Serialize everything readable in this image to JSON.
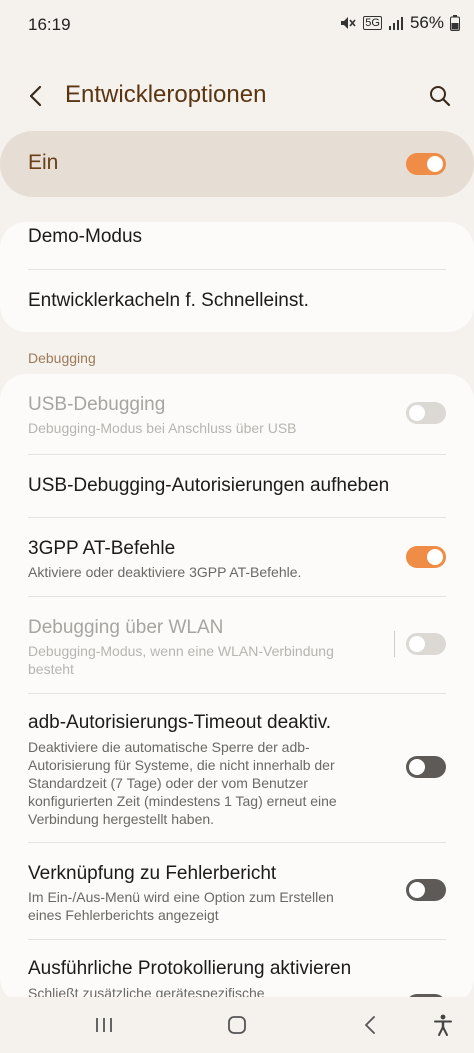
{
  "status_bar": {
    "time": "16:19",
    "network": "5G",
    "battery": "56%",
    "icons": [
      "mute-icon",
      "5g-icon",
      "signal-icon",
      "battery-icon"
    ]
  },
  "app_bar": {
    "title": "Entwickleroptionen",
    "back_icon": "back-arrow-icon",
    "search_icon": "search-icon"
  },
  "master_switch": {
    "label": "Ein",
    "on": true
  },
  "top_items": [
    {
      "title": "Demo-Modus"
    },
    {
      "title": "Entwicklerkacheln f. Schnelleinst."
    }
  ],
  "section": {
    "header": "Debugging"
  },
  "items": [
    {
      "title": "USB-Debugging",
      "subtitle": "Debugging-Modus bei Anschluss über USB",
      "switch": "off",
      "enabled": false
    },
    {
      "title": "USB-Debugging-Autorisierungen aufheben",
      "subtitle": "",
      "switch": "none",
      "enabled": true
    },
    {
      "title": "3GPP AT-Befehle",
      "subtitle": "Aktiviere oder deaktiviere 3GPP AT-Befehle.",
      "switch": "on",
      "enabled": true
    },
    {
      "title": "Debugging über WLAN",
      "subtitle": "Debugging-Modus, wenn eine WLAN-Verbindung besteht",
      "switch": "off",
      "enabled": false
    },
    {
      "title": "adb-Autorisierungs-Timeout deaktiv.",
      "subtitle": "Deaktiviere die automatische Sperre der adb-Autorisierung für Systeme, die nicht innerhalb der Standardzeit (7 Tage) oder der vom Benutzer konfigurierten Zeit (mindestens 1 Tag) erneut eine Verbindung hergestellt haben.",
      "switch": "off",
      "enabled": true
    },
    {
      "title": "Verknüpfung zu Fehlerbericht",
      "subtitle": "Im Ein-/Aus-Menü wird eine Option zum Erstellen eines Fehlerberichts angezeigt",
      "switch": "off",
      "enabled": true
    },
    {
      "title": "Ausführliche Protokollierung aktivieren",
      "subtitle": "Schließt zusätzliche gerätespezifische",
      "switch": "off",
      "enabled": true
    }
  ],
  "colors": {
    "accent": "#ef8c45",
    "title": "#5a3512",
    "background": "#f5f1ec",
    "card": "#fcfbfa"
  },
  "nav_bar": {
    "icons": [
      "recent-apps-icon",
      "home-icon",
      "back-icon",
      "accessibility-icon"
    ]
  }
}
